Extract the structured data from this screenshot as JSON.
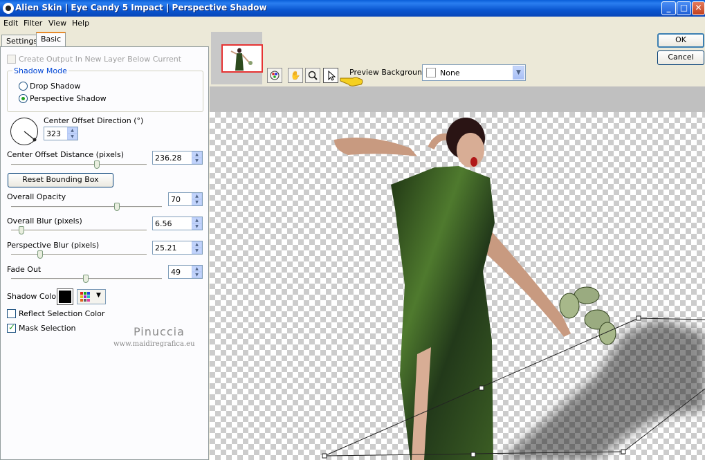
{
  "window": {
    "title": "Alien Skin  |  Eye Candy 5 Impact  |  Perspective Shadow",
    "minimize": "_",
    "maximize": "□",
    "close": "✕"
  },
  "menu": [
    "Edit",
    "Filter",
    "View",
    "Help"
  ],
  "tabs": [
    "Settings",
    "Basic"
  ],
  "settings": {
    "create_output_label": "Create Output In New Layer Below Current",
    "shadow_mode_label": "Shadow Mode",
    "drop_shadow_label": "Drop Shadow",
    "perspective_shadow_label": "Perspective Shadow",
    "selected_mode": "Perspective Shadow",
    "center_offset_direction_label": "Center Offset Direction (°)",
    "center_offset_direction_value": "323",
    "center_offset_distance_label": "Center Offset Distance (pixels)",
    "center_offset_distance_value": "236.28",
    "reset_bounding_box_label": "Reset Bounding Box",
    "overall_opacity_label": "Overall Opacity",
    "overall_opacity_value": "70",
    "overall_blur_label": "Overall Blur (pixels)",
    "overall_blur_value": "6.56",
    "perspective_blur_label": "Perspective Blur (pixels)",
    "perspective_blur_value": "25.21",
    "fade_out_label": "Fade Out",
    "fade_out_value": "49",
    "shadow_color_label": "Shadow Color",
    "shadow_color": "#000000",
    "reflect_selection_color_label": "Reflect Selection Color",
    "mask_selection_label": "Mask Selection",
    "create_output_checked": false,
    "reflect_selection_checked": false,
    "mask_selection_checked": true
  },
  "watermark": {
    "name": "Pinuccia",
    "url": "www.maidiregrafica.eu"
  },
  "preview": {
    "background_label": "Preview Background:",
    "background_value": "None"
  },
  "dialog": {
    "ok_label": "OK",
    "cancel_label": "Cancel"
  },
  "colors": {
    "titlebar": "#0a56d0",
    "accent": "#e68b2c",
    "dress": "#2d4a1e"
  }
}
